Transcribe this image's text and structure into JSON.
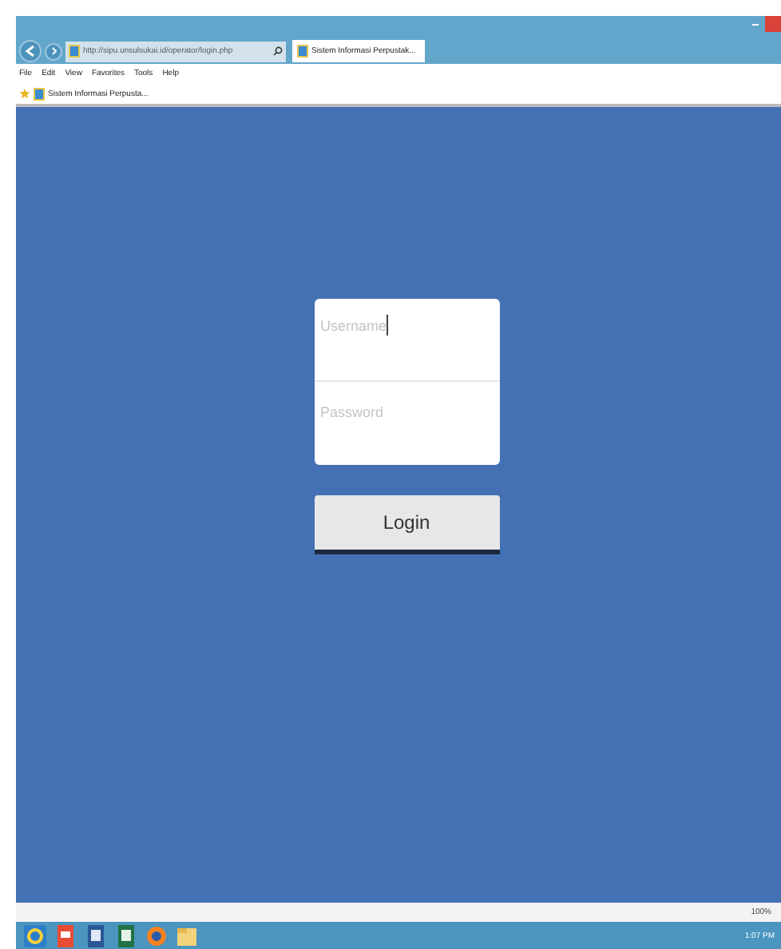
{
  "browser": {
    "address": "http://sipu.unsulsukai.id/operator/login.php",
    "tab_title": "Sistem Informasi Perpustak...",
    "menu": [
      "File",
      "Edit",
      "View",
      "Favorites",
      "Tools",
      "Help"
    ],
    "favorite": "Sistem Informasi Perpusta...",
    "zoom": "100%"
  },
  "login": {
    "username_placeholder": "Username",
    "password_placeholder": "Password",
    "button": "Login"
  },
  "taskbar": {
    "apps": [
      {
        "kind": "ie"
      },
      {
        "kind": "pdf"
      },
      {
        "kind": "word"
      },
      {
        "kind": "excel"
      },
      {
        "kind": "firefox"
      },
      {
        "kind": "folder"
      }
    ],
    "time": "1:07 PM"
  }
}
